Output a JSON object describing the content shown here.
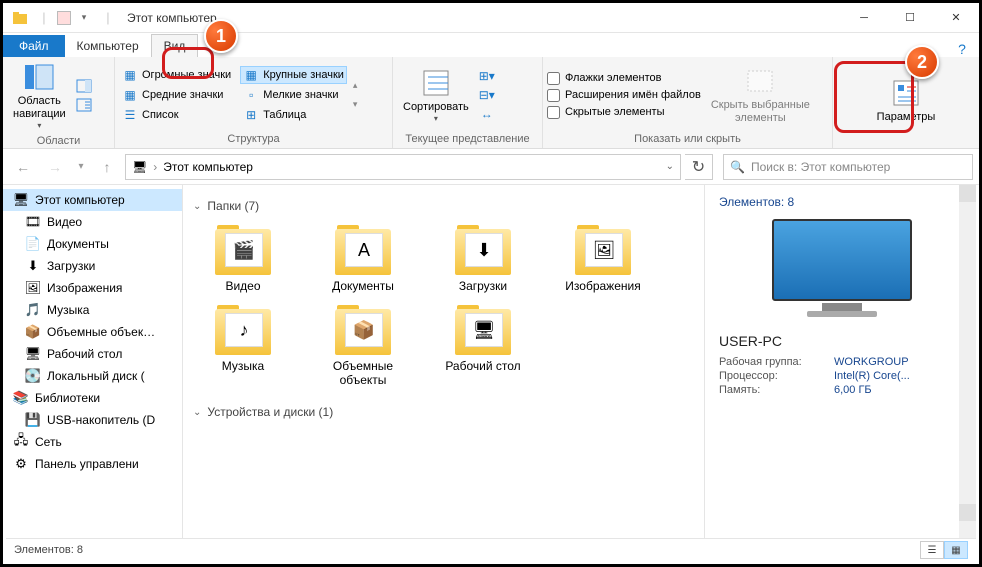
{
  "title": "Этот компьютер",
  "tabs": {
    "file": "Файл",
    "computer": "Компьютер",
    "view": "Вид"
  },
  "ribbon": {
    "panes": {
      "nav_area": "Область\nнавигации",
      "group": "Области"
    },
    "layout": {
      "huge": "Огромные значки",
      "large": "Крупные значки",
      "small": "Мелкие значки",
      "medium": "Средние значки",
      "list": "Список",
      "table": "Таблица",
      "group": "Структура"
    },
    "current": {
      "sort": "Сортировать",
      "group": "Текущее представление"
    },
    "show": {
      "checkboxes": "Флажки элементов",
      "extensions": "Расширения имён файлов",
      "hidden": "Скрытые элементы",
      "hide_selected": "Скрыть выбранные\nэлементы",
      "group": "Показать или скрыть"
    },
    "options": "Параметры"
  },
  "address": "Этот компьютер",
  "search_placeholder": "Поиск в: Этот компьютер",
  "sidebar": [
    {
      "label": "Этот компьютер",
      "icon": "🖥",
      "root": true
    },
    {
      "label": "Видео",
      "icon": "🎞"
    },
    {
      "label": "Документы",
      "icon": "📄"
    },
    {
      "label": "Загрузки",
      "icon": "⬇"
    },
    {
      "label": "Изображения",
      "icon": "🖼"
    },
    {
      "label": "Музыка",
      "icon": "🎵"
    },
    {
      "label": "Объемные объек…",
      "icon": "📦"
    },
    {
      "label": "Рабочий стол",
      "icon": "🖥"
    },
    {
      "label": "Локальный диск (",
      "icon": "💽"
    },
    {
      "label": "Библиотеки",
      "icon": "📚",
      "lib": true
    },
    {
      "label": "USB-накопитель (D",
      "icon": "💾"
    },
    {
      "label": "Сеть",
      "icon": "🖧",
      "lib": true
    },
    {
      "label": "Панель управлени",
      "icon": "⚙",
      "lib": true
    }
  ],
  "sections": {
    "folders": {
      "title": "Папки (7)"
    },
    "drives": {
      "title": "Устройства и диски (1)"
    }
  },
  "folders": [
    {
      "label": "Видео",
      "glyph": "🎬"
    },
    {
      "label": "Документы",
      "glyph": "A"
    },
    {
      "label": "Загрузки",
      "glyph": "⬇"
    },
    {
      "label": "Изображения",
      "glyph": "🖼"
    },
    {
      "label": "Музыка",
      "glyph": "♪"
    },
    {
      "label": "Объемные\nобъекты",
      "glyph": "📦"
    },
    {
      "label": "Рабочий стол",
      "glyph": "🖥"
    }
  ],
  "details": {
    "title": "Элементов: 8",
    "pc_name": "USER-PC",
    "specs": [
      {
        "label": "Рабочая группа:",
        "value": "WORKGROUP"
      },
      {
        "label": "Процессор:",
        "value": "Intel(R) Core(..."
      },
      {
        "label": "Память:",
        "value": "6,00 ГБ"
      }
    ]
  },
  "status": "Элементов: 8",
  "callouts": {
    "one": "1",
    "two": "2"
  }
}
